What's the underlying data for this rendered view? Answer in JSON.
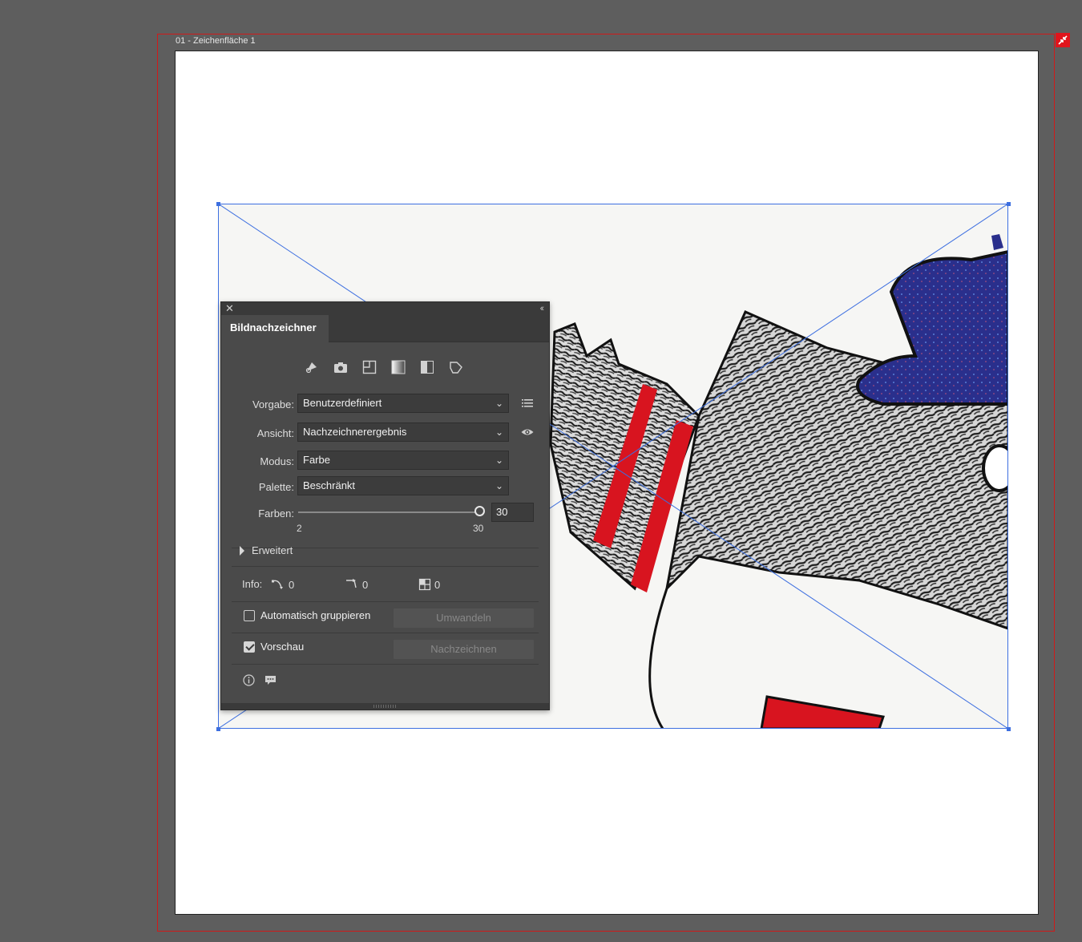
{
  "canvas": {
    "artboard_label": "01 - Zeichenfläche 1"
  },
  "panel": {
    "tab_title": "Bildnachzeichner",
    "preset_icons": [
      "auto-color-icon",
      "high-color-icon",
      "low-color-icon",
      "grayscale-icon",
      "black-white-icon",
      "outline-icon"
    ],
    "vorgabe": {
      "label": "Vorgabe:",
      "value": "Benutzerdefiniert"
    },
    "ansicht": {
      "label": "Ansicht:",
      "value": "Nachzeichnerergebnis"
    },
    "modus": {
      "label": "Modus:",
      "value": "Farbe"
    },
    "palette": {
      "label": "Palette:",
      "value": "Beschränkt"
    },
    "farben": {
      "label": "Farben:",
      "value": "30",
      "min": "2",
      "max": "30",
      "fraction": 1.0
    },
    "advanced_label": "Erweitert",
    "info": {
      "label": "Info:",
      "paths": "0",
      "anchors": "0",
      "colors": "0"
    },
    "auto_group": {
      "label": "Automatisch gruppieren",
      "checked": false
    },
    "convert_button": "Umwandeln",
    "preview": {
      "label": "Vorschau",
      "checked": true
    },
    "trace_button": "Nachzeichnen"
  },
  "colors": {
    "bleed": "#d01a1a",
    "selection": "#3d6fe0",
    "panel_bg": "#4a4a4a",
    "drawing_red": "#d8141f",
    "drawing_blue": "#2a2f8c"
  }
}
